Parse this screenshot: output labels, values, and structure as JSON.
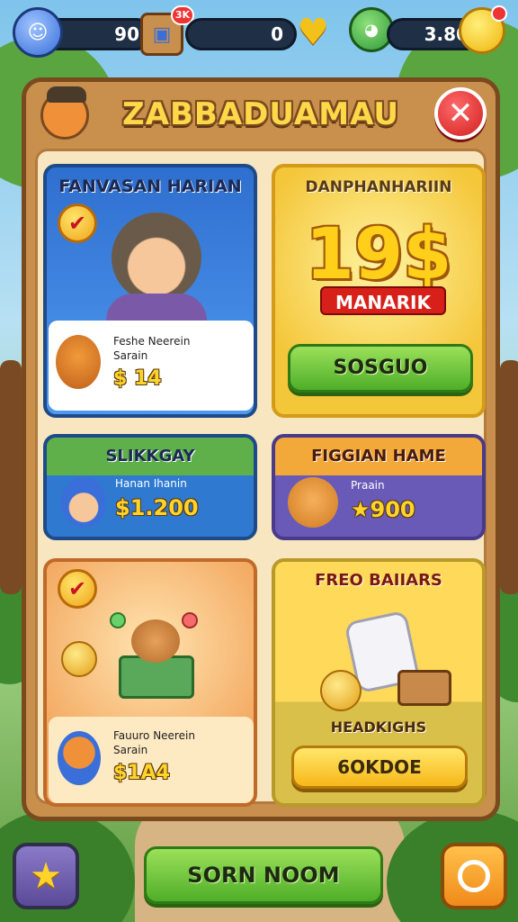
{
  "top_bar": {
    "gems": "90",
    "gems_icon": "blue-blob-icon",
    "shop_badge": "3K",
    "coins": "0",
    "coins_icon": "gold-heart-icon",
    "energy": "3.80",
    "energy_icon": "gold-coin-icon",
    "pet_icon": "green-dragon-icon"
  },
  "panel": {
    "title": "ZABBADUAMAU",
    "close_icon": "close-icon"
  },
  "cards": {
    "daily": {
      "title": "FANVASAN HARIAN",
      "label_line1": "Feshe Neerein",
      "label_line2": "Sarain",
      "price": "$ 14"
    },
    "promo": {
      "title": "DANPHANHARIIN",
      "big_number": "19$",
      "banner": "MANARIK",
      "button": "SOSGUO"
    },
    "special": {
      "title": "SLIKKGAY",
      "label": "Hanan Ihanin",
      "price": "$1.200"
    },
    "free_game": {
      "title": "FIGGIAN HAME",
      "label": "Praain",
      "price": "★900"
    },
    "bundle": {
      "label_line1": "Fauuro Neerein",
      "label_line2": "Sarain",
      "price": "$1A4"
    },
    "free_items": {
      "title": "FREO BAIIARS",
      "subtitle": "HEADKIGHS",
      "button": "6OKDOE"
    }
  },
  "bottom_bar": {
    "left_icon": "star-icon",
    "center_button": "SORN NOOM",
    "right_icon": "search-icon"
  }
}
